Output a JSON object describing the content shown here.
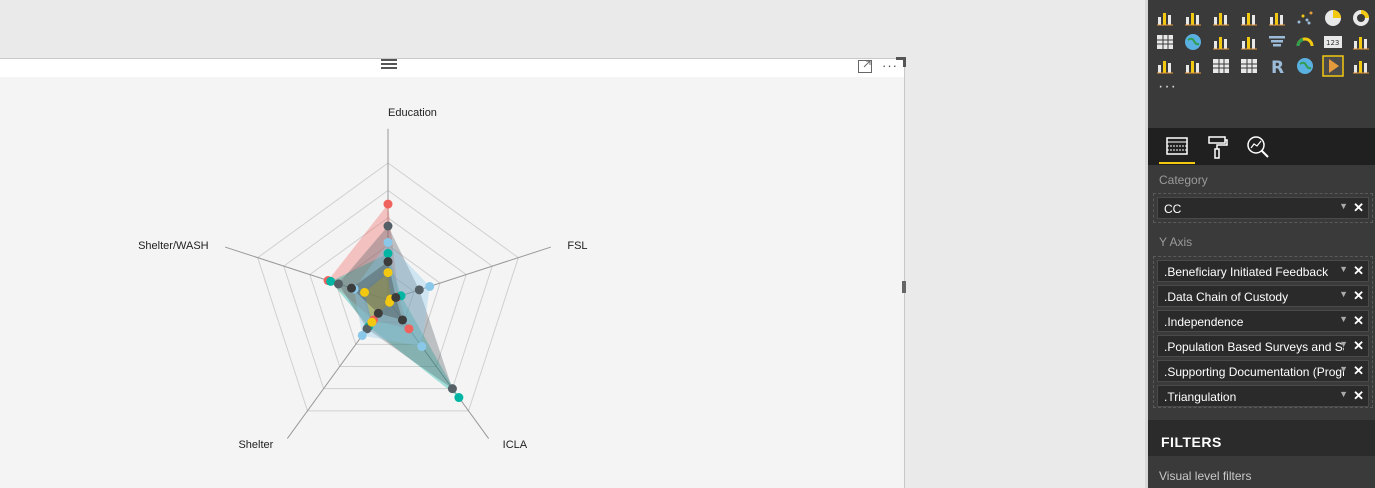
{
  "visual": {
    "more_options_label": "···"
  },
  "chart_data": {
    "type": "radar",
    "axes": [
      "Education",
      "FSL",
      "ICLA",
      "Shelter",
      "Shelter/WASH"
    ],
    "max": 5,
    "series": [
      {
        "color": "#f0625d",
        "values": [
          3.5,
          0.4,
          1.3,
          0.9,
          2.3
        ]
      },
      {
        "color": "#00b5a3",
        "values": [
          1.7,
          0.5,
          4.4,
          1.2,
          2.2
        ]
      },
      {
        "color": "#555f66",
        "values": [
          2.7,
          1.2,
          4.0,
          1.3,
          1.9
        ]
      },
      {
        "color": "#8ac8ea",
        "values": [
          2.1,
          1.6,
          2.1,
          1.6,
          1.3
        ]
      },
      {
        "color": "#f2c811",
        "values": [
          1.0,
          0.1,
          0.1,
          1.0,
          0.9
        ]
      },
      {
        "color": "#3c3c3c",
        "values": [
          1.4,
          0.3,
          0.9,
          0.6,
          1.4
        ]
      }
    ]
  },
  "gallery": {
    "more_label": "···"
  },
  "wells": {
    "category": {
      "title": "Category",
      "fields": [
        "CC"
      ]
    },
    "y_axis": {
      "title": "Y Axis",
      "fields": [
        ".Beneficiary Initiated Feedback",
        ".Data Chain of Custody",
        ".Independence",
        ".Population Based Surveys and Sample",
        ".Supporting Documentation (Programme)",
        ".Triangulation"
      ]
    }
  },
  "filters": {
    "title": "FILTERS",
    "visual_level": "Visual level filters"
  },
  "colors": {
    "accent": "#f2c811",
    "pane_bg": "#3a3a3a"
  }
}
